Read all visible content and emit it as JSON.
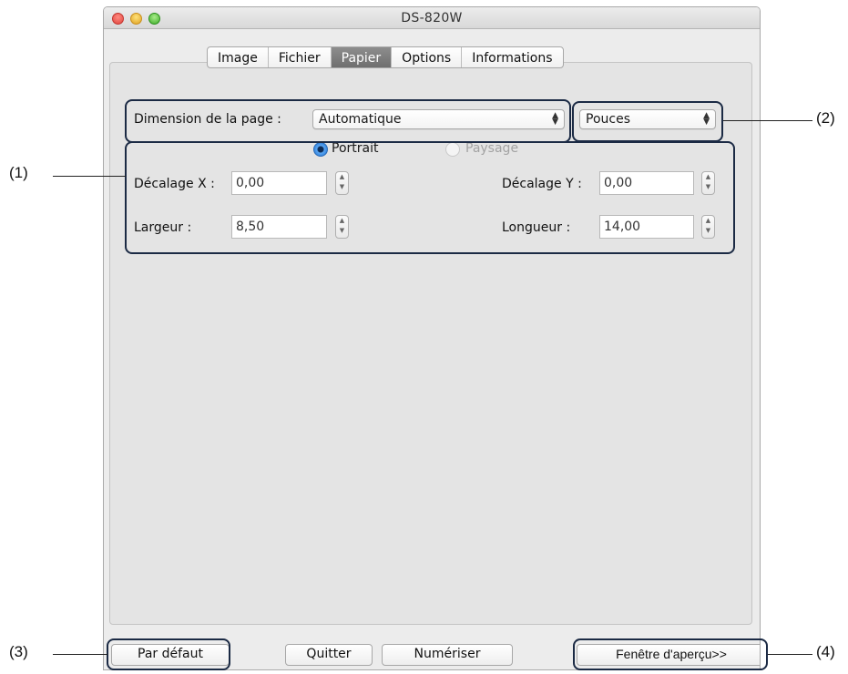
{
  "window": {
    "title": "DS-820W"
  },
  "tabs": [
    "Image",
    "Fichier",
    "Papier",
    "Options",
    "Informations"
  ],
  "paper": {
    "page_size_label": "Dimension de la page :",
    "page_size_value": "Automatique",
    "units_value": "Pouces",
    "orientation": {
      "portrait": "Portrait",
      "landscape": "Paysage",
      "selected": "Portrait"
    },
    "offset_x_label": "Décalage X :",
    "offset_x_value": "0,00",
    "offset_y_label": "Décalage Y :",
    "offset_y_value": "0,00",
    "width_label": "Largeur :",
    "width_value": "8,50",
    "length_label": "Longueur :",
    "length_value": "14,00"
  },
  "buttons": {
    "default": "Par défaut",
    "quit": "Quitter",
    "scan": "Numériser",
    "preview": "Fenêtre d'aperçu>>"
  },
  "callouts": {
    "c1": "(1)",
    "c2": "(2)",
    "c3": "(3)",
    "c4": "(4)"
  },
  "colors": {
    "selected_tab": "#7d7d7d",
    "radio_selected": "#2f7fd9",
    "callout_border": "#1b2a44"
  }
}
